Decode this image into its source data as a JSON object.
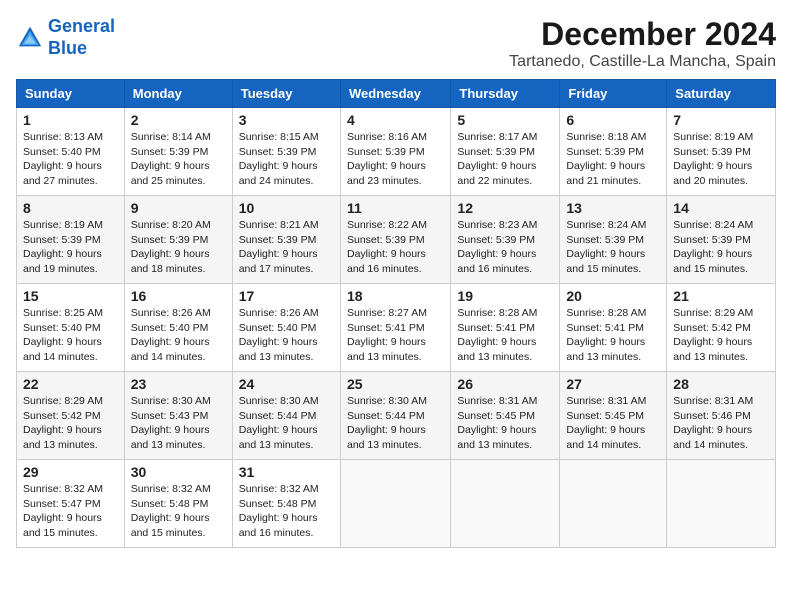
{
  "header": {
    "logo_line1": "General",
    "logo_line2": "Blue",
    "month_title": "December 2024",
    "location": "Tartanedo, Castille-La Mancha, Spain"
  },
  "days_of_week": [
    "Sunday",
    "Monday",
    "Tuesday",
    "Wednesday",
    "Thursday",
    "Friday",
    "Saturday"
  ],
  "weeks": [
    [
      {
        "day": "1",
        "sunrise": "8:13 AM",
        "sunset": "5:40 PM",
        "daylight": "9 hours and 27 minutes"
      },
      {
        "day": "2",
        "sunrise": "8:14 AM",
        "sunset": "5:39 PM",
        "daylight": "9 hours and 25 minutes"
      },
      {
        "day": "3",
        "sunrise": "8:15 AM",
        "sunset": "5:39 PM",
        "daylight": "9 hours and 24 minutes"
      },
      {
        "day": "4",
        "sunrise": "8:16 AM",
        "sunset": "5:39 PM",
        "daylight": "9 hours and 23 minutes"
      },
      {
        "day": "5",
        "sunrise": "8:17 AM",
        "sunset": "5:39 PM",
        "daylight": "9 hours and 22 minutes"
      },
      {
        "day": "6",
        "sunrise": "8:18 AM",
        "sunset": "5:39 PM",
        "daylight": "9 hours and 21 minutes"
      },
      {
        "day": "7",
        "sunrise": "8:19 AM",
        "sunset": "5:39 PM",
        "daylight": "9 hours and 20 minutes"
      }
    ],
    [
      {
        "day": "8",
        "sunrise": "8:19 AM",
        "sunset": "5:39 PM",
        "daylight": "9 hours and 19 minutes"
      },
      {
        "day": "9",
        "sunrise": "8:20 AM",
        "sunset": "5:39 PM",
        "daylight": "9 hours and 18 minutes"
      },
      {
        "day": "10",
        "sunrise": "8:21 AM",
        "sunset": "5:39 PM",
        "daylight": "9 hours and 17 minutes"
      },
      {
        "day": "11",
        "sunrise": "8:22 AM",
        "sunset": "5:39 PM",
        "daylight": "9 hours and 16 minutes"
      },
      {
        "day": "12",
        "sunrise": "8:23 AM",
        "sunset": "5:39 PM",
        "daylight": "9 hours and 16 minutes"
      },
      {
        "day": "13",
        "sunrise": "8:24 AM",
        "sunset": "5:39 PM",
        "daylight": "9 hours and 15 minutes"
      },
      {
        "day": "14",
        "sunrise": "8:24 AM",
        "sunset": "5:39 PM",
        "daylight": "9 hours and 15 minutes"
      }
    ],
    [
      {
        "day": "15",
        "sunrise": "8:25 AM",
        "sunset": "5:40 PM",
        "daylight": "9 hours and 14 minutes"
      },
      {
        "day": "16",
        "sunrise": "8:26 AM",
        "sunset": "5:40 PM",
        "daylight": "9 hours and 14 minutes"
      },
      {
        "day": "17",
        "sunrise": "8:26 AM",
        "sunset": "5:40 PM",
        "daylight": "9 hours and 13 minutes"
      },
      {
        "day": "18",
        "sunrise": "8:27 AM",
        "sunset": "5:41 PM",
        "daylight": "9 hours and 13 minutes"
      },
      {
        "day": "19",
        "sunrise": "8:28 AM",
        "sunset": "5:41 PM",
        "daylight": "9 hours and 13 minutes"
      },
      {
        "day": "20",
        "sunrise": "8:28 AM",
        "sunset": "5:41 PM",
        "daylight": "9 hours and 13 minutes"
      },
      {
        "day": "21",
        "sunrise": "8:29 AM",
        "sunset": "5:42 PM",
        "daylight": "9 hours and 13 minutes"
      }
    ],
    [
      {
        "day": "22",
        "sunrise": "8:29 AM",
        "sunset": "5:42 PM",
        "daylight": "9 hours and 13 minutes"
      },
      {
        "day": "23",
        "sunrise": "8:30 AM",
        "sunset": "5:43 PM",
        "daylight": "9 hours and 13 minutes"
      },
      {
        "day": "24",
        "sunrise": "8:30 AM",
        "sunset": "5:44 PM",
        "daylight": "9 hours and 13 minutes"
      },
      {
        "day": "25",
        "sunrise": "8:30 AM",
        "sunset": "5:44 PM",
        "daylight": "9 hours and 13 minutes"
      },
      {
        "day": "26",
        "sunrise": "8:31 AM",
        "sunset": "5:45 PM",
        "daylight": "9 hours and 13 minutes"
      },
      {
        "day": "27",
        "sunrise": "8:31 AM",
        "sunset": "5:45 PM",
        "daylight": "9 hours and 14 minutes"
      },
      {
        "day": "28",
        "sunrise": "8:31 AM",
        "sunset": "5:46 PM",
        "daylight": "9 hours and 14 minutes"
      }
    ],
    [
      {
        "day": "29",
        "sunrise": "8:32 AM",
        "sunset": "5:47 PM",
        "daylight": "9 hours and 15 minutes"
      },
      {
        "day": "30",
        "sunrise": "8:32 AM",
        "sunset": "5:48 PM",
        "daylight": "9 hours and 15 minutes"
      },
      {
        "day": "31",
        "sunrise": "8:32 AM",
        "sunset": "5:48 PM",
        "daylight": "9 hours and 16 minutes"
      },
      null,
      null,
      null,
      null
    ]
  ]
}
